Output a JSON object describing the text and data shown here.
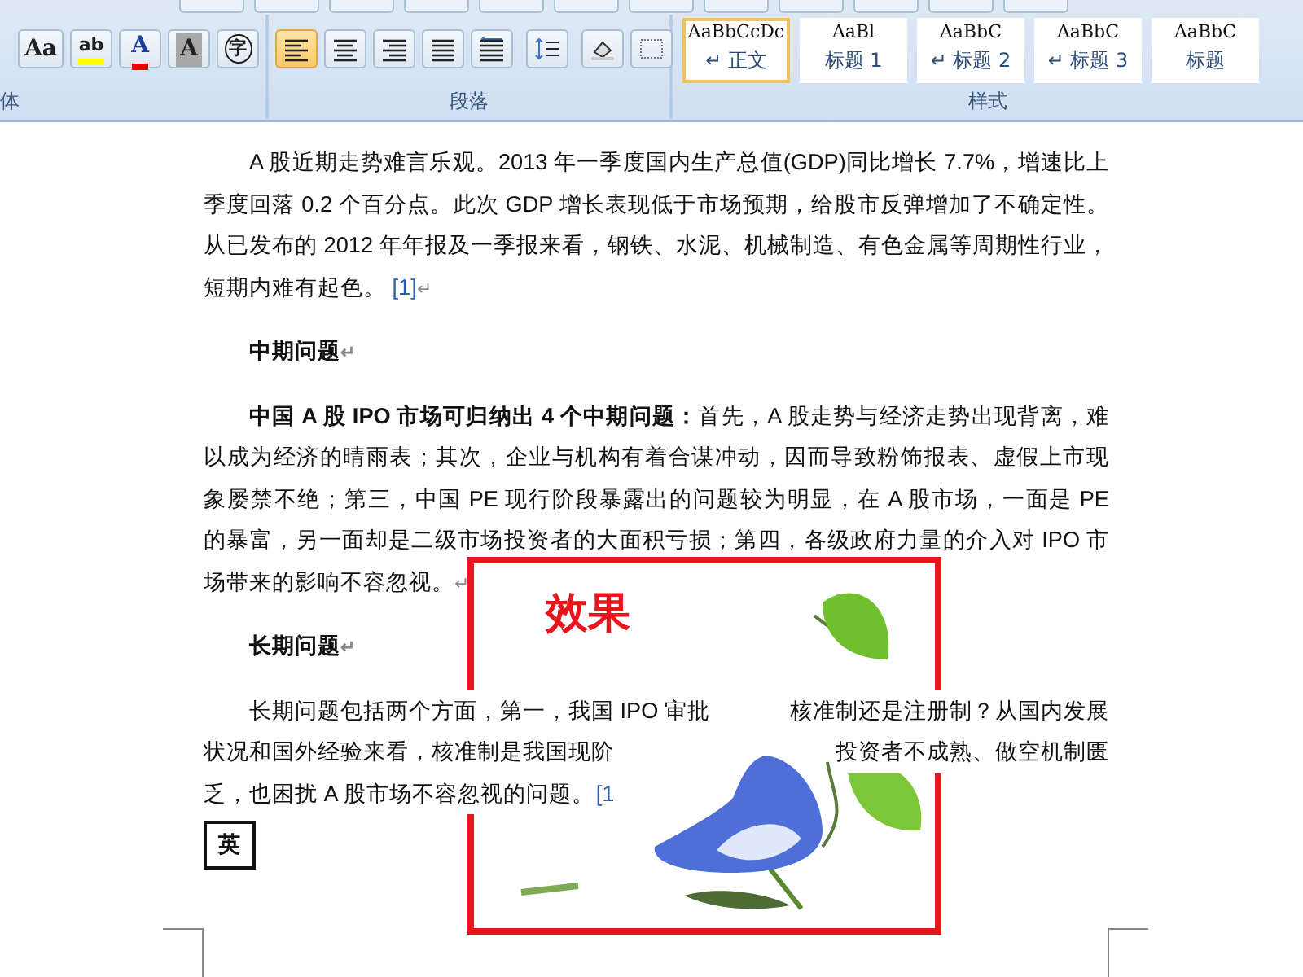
{
  "ribbon": {
    "font_group": {
      "label": "体",
      "tools": [
        {
          "kind": "change-case",
          "label": "Aa"
        },
        {
          "kind": "highlight",
          "label": "ab"
        },
        {
          "kind": "font-color",
          "label": "A"
        },
        {
          "kind": "char-shading",
          "label": "A"
        },
        {
          "kind": "enclose",
          "label": "字"
        }
      ]
    },
    "paragraph_group": {
      "label": "段落",
      "tools": [
        {
          "kind": "align-left",
          "selected": true
        },
        {
          "kind": "align-center",
          "selected": false
        },
        {
          "kind": "align-right",
          "selected": false
        },
        {
          "kind": "justify",
          "selected": false
        },
        {
          "kind": "distribute",
          "selected": false
        },
        {
          "kind": "line-spacing",
          "selected": false
        },
        {
          "kind": "shading",
          "selected": false
        },
        {
          "kind": "borders",
          "selected": false
        }
      ]
    },
    "styles_group": {
      "label": "样式",
      "styles": [
        {
          "preview": "AaBbCcDc",
          "label": "↵ 正文",
          "selected": true
        },
        {
          "preview": "AaBl",
          "label": "标题 1",
          "selected": false
        },
        {
          "preview": "AaBbC",
          "label": "↵ 标题 2",
          "selected": false
        },
        {
          "preview": "AaBbC",
          "label": "↵ 标题 3",
          "selected": false
        },
        {
          "preview": "AaBbC",
          "label": "标题",
          "selected": false
        }
      ]
    }
  },
  "document": {
    "paragraphs": [
      {
        "kind": "body",
        "text": "A 股近期走势难言乐观。2013 年一季度国内生产总值(GDP)同比增长 7.7%，增速比上季度回落 0.2 个百分点。此次 GDP 增长表现低于市场预期，给股市反弹增加了不确定性。从已发布的 2012 年年报及一季报来看，钢铁、水泥、机械制造、有色金属等周期性行业，短期内难有起色。",
        "ref": "[1]",
        "end_mark": "↵"
      },
      {
        "kind": "heading",
        "text": "中期问题",
        "end_mark": "↵"
      },
      {
        "kind": "body",
        "text": "**中国 A 股 IPO 市场可归纳出 4 个中期问题：**首先，A 股走势与经济走势出现背离，难以成为经济的晴雨表；其次，企业与机构有着合谋冲动，因而导致粉饰报表、虚假上市现象屡禁不绝；第三，中国 PE 现行阶段暴露出的问题较为明显，在 A 股市场，一面是 PE 的暴富，另一面却是二级市场投资者的大面积亏损；第四，各级政府力量的介入对 IPO 市场带来的影响不容忽视。",
        "end_mark": "↵"
      },
      {
        "kind": "heading",
        "text": "长期问题",
        "end_mark": "↵"
      },
      {
        "kind": "lines",
        "lines": [
          {
            "segments": [
              "长期问题包括两个方面，第一，我国 IPO 审批",
              "核准制还是注册制？从国内发展"
            ]
          },
          {
            "segments": [
              "状况和国外经验来看，核准制是我国现阶",
              "投资者不成熟、做空机制匮"
            ]
          },
          {
            "segments": [
              "乏，也困扰 A 股市场不容忽视的问题。",
              "[1"
            ]
          }
        ]
      },
      {
        "kind": "enclosed",
        "text": "英"
      }
    ],
    "picture": {
      "caption": "效果"
    }
  }
}
